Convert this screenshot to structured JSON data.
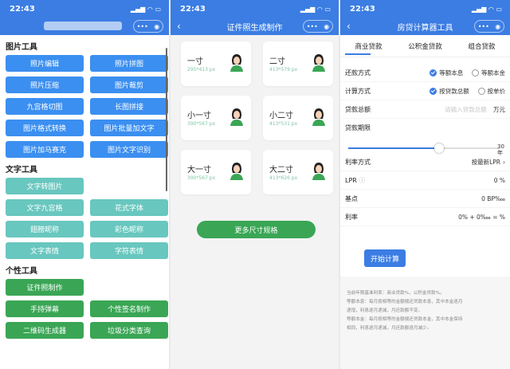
{
  "p1": {
    "time": "22:43",
    "sections": [
      {
        "title": "图片工具",
        "color": "blue",
        "items": [
          "照片编辑",
          "照片拼图",
          "照片压缩",
          "图片裁剪",
          "九宫格切图",
          "长图拼接",
          "图片格式转换",
          "图片批量加文字",
          "图片加马赛克",
          "图片文字识别"
        ]
      },
      {
        "title": "文字工具",
        "color": "teal",
        "items": [
          "文字转图片",
          "",
          "文字九宫格",
          "花式字体",
          "翅膀昵称",
          "彩色昵称",
          "文字表情",
          "字符表情"
        ]
      },
      {
        "title": "个性工具",
        "color": "green",
        "items": [
          "证件照制作",
          "",
          "手持弹幕",
          "个性签名制作",
          "二维码生成器",
          "垃圾分类查询"
        ]
      }
    ]
  },
  "p2": {
    "time": "22:43",
    "title": "证件照生成制作",
    "sizes": [
      {
        "name": "一寸",
        "px": "295*413 px"
      },
      {
        "name": "二寸",
        "px": "413*579 px"
      },
      {
        "name": "小一寸",
        "px": "390*567 px"
      },
      {
        "name": "小二寸",
        "px": "413*531 px"
      },
      {
        "name": "大一寸",
        "px": "390*567 px"
      },
      {
        "name": "大二寸",
        "px": "413*626 px"
      }
    ],
    "more": "更多尺寸规格"
  },
  "p3": {
    "time": "22:43",
    "title": "房贷计算器工具",
    "tabs": [
      "商业贷款",
      "公积金贷款",
      "组合贷款"
    ],
    "repay_label": "还款方式",
    "repay_opt1": "等额本息",
    "repay_opt2": "等额本金",
    "calc_label": "计算方式",
    "calc_opt1": "按贷款总额",
    "calc_opt2": "按单价",
    "total_label": "贷款总额",
    "total_placeholder": "请输入贷款总额",
    "total_unit": "万元",
    "term_label": "贷款期限",
    "term_value": "30",
    "term_unit": "年",
    "term_fraction": 0.6,
    "rate_mode_label": "利率方式",
    "rate_mode_value": "按最新LPR",
    "lpr_label": "LPR",
    "lpr_value": "0 %",
    "bp_label": "基点",
    "bp_value": "0 BP‱",
    "rate_label": "利率",
    "rate_value": "0% + 0‱ = %",
    "start": "开始计算",
    "note1": "当前年限基准利率：商业贷款%，公积金贷款%。",
    "note2a": "等额本息：每月按相等的金额偿还贷款本息，其中本金逐月",
    "note2b": "递增，利息逐月递减，月还款额不变。",
    "note3a": "等额本金：每月按相等的金额偿还贷款本金，其中本金保持",
    "note3b": "相同，利息逐月递减，月还款额逐月减少。"
  }
}
